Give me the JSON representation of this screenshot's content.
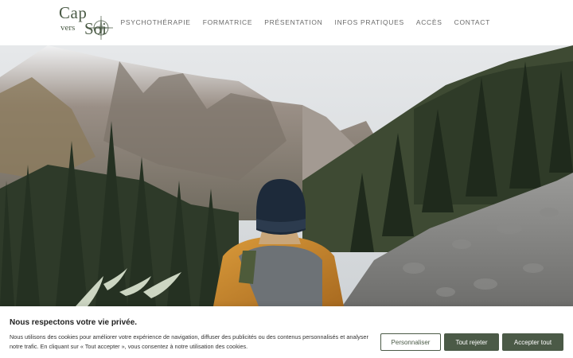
{
  "logo": {
    "line1": "Cap",
    "line2a": "vers",
    "line2b": "Soi",
    "icon": "compass-icon"
  },
  "nav": {
    "items": [
      {
        "label": "PSYCHOTHÉRAPIE"
      },
      {
        "label": "FORMATRICE"
      },
      {
        "label": "PRÉSENTATION"
      },
      {
        "label": "INFOS PRATIQUES"
      },
      {
        "label": "ACCÈS"
      },
      {
        "label": "CONTACT"
      }
    ]
  },
  "hero": {
    "image": "hiker-in-mountain-forest"
  },
  "cookie_banner": {
    "title": "Nous respectons votre vie privée.",
    "text": "Nous utilisons des cookies pour améliorer votre expérience de navigation, diffuser des publicités ou des contenus personnalisés et analyser notre trafic. En cliquant sur « Tout accepter », vous consentez à notre utilisation des cookies.",
    "customize_label": "Personnaliser",
    "reject_label": "Tout rejeter",
    "accept_label": "Accepter tout"
  },
  "colors": {
    "brand_green": "#4b5a47",
    "nav_text": "#6a6a6a"
  }
}
